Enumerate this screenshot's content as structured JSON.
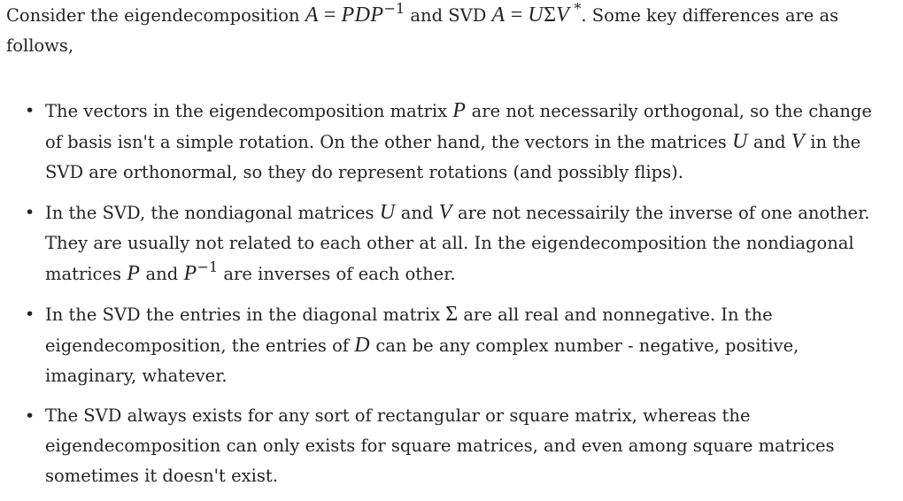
{
  "intro": {
    "t1": "Consider the eigendecomposition ",
    "math_eig_lhs": "A",
    "math_eig_eq": " = ",
    "math_eig_rhs": "PDP",
    "math_eig_exp": "−1",
    "t2": " and SVD ",
    "math_svd_lhs": "A",
    "math_svd_eq": " = ",
    "math_svd_u": "U",
    "math_svd_sigma": "Σ",
    "math_svd_v": "V",
    "math_svd_star": " *",
    "t3": ". Some key differences are as follows,"
  },
  "bullet_glyph": "•",
  "points": [
    {
      "t1": "The vectors in the eigendecomposition matrix ",
      "m1": "P",
      "t2": " are not necessarily orthogonal, so the change of basis isn't a simple rotation. On the other hand, the vectors in the matrices ",
      "m2": "U",
      "t3": " and ",
      "m3": "V",
      "t4": " in the SVD are orthonormal, so they do represent rotations (and possibly flips)."
    },
    {
      "t1": "In the SVD, the nondiagonal matrices ",
      "m1": "U",
      "t2": " and ",
      "m2": "V",
      "t3": " are not necessairily the inverse of one another. They are usually not related to each other at all. In the eigendecomposition the nondiagonal matrices ",
      "m3": "P",
      "t4": " and ",
      "m4": "P",
      "m4_exp": "−1",
      "t5": " are inverses of each other."
    },
    {
      "t1": "In the SVD the entries in the diagonal matrix ",
      "m1": "Σ",
      "t2": " are all real and nonnegative. In the eigendecomposition, the entries of ",
      "m2": "D",
      "t3": " can be any complex number - negative, positive, imaginary, whatever."
    },
    {
      "t1": "The SVD always exists for any sort of rectangular or square matrix, whereas the eigendecomposition can only exists for square matrices, and even among square matrices sometimes it doesn't exist."
    }
  ]
}
